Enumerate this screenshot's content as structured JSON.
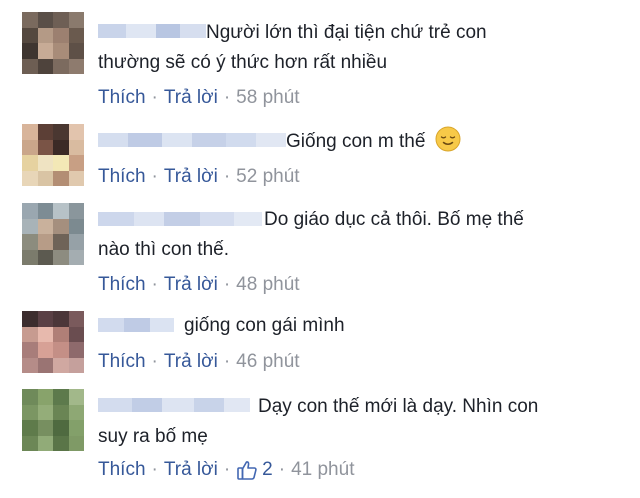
{
  "comments": [
    {
      "text_line1": "Người lớn thì đại tiện chứ trẻ con",
      "text_line2": "thường sẽ có ý thức hơn rất nhiều",
      "like_label": "Thích",
      "reply_label": "Trả lời",
      "time": "58 phút"
    },
    {
      "text_line1": "Giống con m thế",
      "emoji": "smiling-face-emoji",
      "like_label": "Thích",
      "reply_label": "Trả lời",
      "time": "52 phút"
    },
    {
      "text_line1": "Do giáo dục cả thôi. Bố mẹ thế",
      "text_line2": "nào thì con thế.",
      "like_label": "Thích",
      "reply_label": "Trả lời",
      "time": "48 phút"
    },
    {
      "text_line1": "giống con gái mình",
      "like_label": "Thích",
      "reply_label": "Trả lời",
      "time": "46 phút"
    },
    {
      "text_line1": "Dạy con thế mới là dạy. Nhìn con",
      "text_line2": "suy ra bố mẹ",
      "like_label": "Thích",
      "reply_label": "Trả lời",
      "like_count": "2",
      "time": "41 phút"
    }
  ],
  "separator": "·",
  "colors": {
    "link": "#365899",
    "meta": "#90949c",
    "text": "#1d2129"
  },
  "icons": [
    "thumbs-up-icon",
    "smiling-face-emoji"
  ]
}
